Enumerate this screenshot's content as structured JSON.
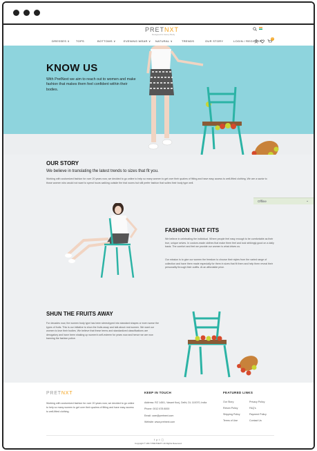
{
  "browser": {
    "dots": 3
  },
  "header": {
    "logo_prefix": "PRET",
    "logo_suffix": "NXT",
    "tagline": "Designed for Every Body",
    "nav": [
      "DRESSES ∨",
      "TOPS",
      "BOTTOMS ∨",
      "EVENING WEAR ∨",
      "NATURAL ∨",
      "TRENDS",
      "OUR STORY",
      "LOGIN / REGISTER"
    ],
    "icons": [
      "search-icon",
      "user-icon",
      "heart-icon",
      "cart-icon"
    ],
    "cart_count": "0"
  },
  "hero": {
    "title": "KNOW US",
    "text": "With PretNext we aim to reach out to women and make fashion that makes them feel confident within their bodies."
  },
  "story": {
    "title": "OUR STORY",
    "lead": "We believe in translating the latest trends to sizes that fit you.",
    "text": "Working with customized fashion for over 20 years now, we decided to go online to help so many women to get over their qualms of fitting and have easy access to well-fitted clothing. We are a savior to those women who would not want to spend hours walking outside the trial rooms but still prefer fashion that suites their body type well."
  },
  "offline": {
    "label": "Offline"
  },
  "fit": {
    "title": "FASHION THAT FITS",
    "p1": "We believe in celebrating the individual. Where people feel easy enough to be comfortable as their true, unique selves. In custom-made clothes that make them feel and look strikingly good on a daily basis. The comfort and feel we provide our women is what drives us.",
    "p2": "Our mission is to give our women the freedom to choose their styles from the varied range of collection and have them made especially for them in sizes that fit them and help them reveal their personality through their outfits. At an affordable price."
  },
  "fruits": {
    "title": "SHUN THE FRUITS AWAY",
    "text": "For decades now, the women body type has been stereotyped into standard shapes or even worse the types of fruits. This is our initiative to shun the fruits away and talk about real women. We want our women to love their bodies. We believe that these terms and standardized classifications are derogatory and have been shaking up women's self-esteem for years now and hence we are now banning the fashion police."
  },
  "footer": {
    "logo_prefix": "PRET",
    "logo_suffix": "NXT",
    "about": "Working with customized fashion for over 20 years now, we decided to go online to help so many women to get over their qualms of fitting and have easy access to well-fitted clothing.",
    "keep_title": "KEEP IN TOUCH",
    "address": "Address: RZ 145/1, Vasant Kunj, Delhi, DL 110070, India",
    "phone": "Phone: 0012 678 8000",
    "email": "Email: care@pretnext.com",
    "website": "Website: www.pretnext.com",
    "links_title": "FEATURED LINKS",
    "links_col1": [
      "Our Story",
      "Return Policy",
      "Shipping Policy",
      "Terms of Use"
    ],
    "links_col2": [
      "Privacy Policy",
      "FAQ's",
      "Payment Policy",
      "Contact Us"
    ],
    "social_icons": [
      "facebook-icon",
      "pinterest-icon",
      "twitter-icon",
      "instagram-icon"
    ],
    "copyright": "Copyright © 2017 PRETNEXT. All Rights Reserved."
  },
  "colors": {
    "teal": "#8ed4dd",
    "chair": "#2bb3a5",
    "accent": "#f3a21c"
  }
}
